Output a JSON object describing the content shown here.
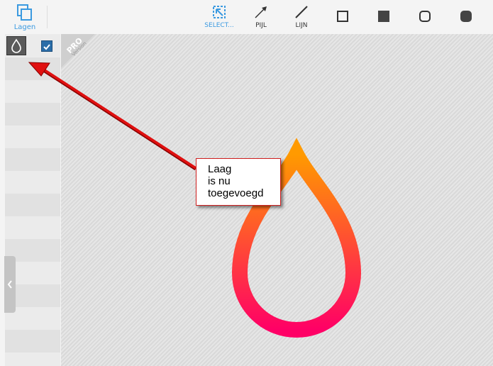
{
  "toolbar": {
    "layers_label": "Lagen",
    "tools": [
      {
        "label": "SELECT...",
        "icon": "select-icon",
        "active": true
      },
      {
        "label": "PIJL",
        "icon": "arrow-icon"
      },
      {
        "label": "LIJN",
        "icon": "line-icon"
      },
      {
        "label": "",
        "icon": "rectangle-outline-icon"
      },
      {
        "label": "",
        "icon": "rectangle-filled-icon"
      },
      {
        "label": "",
        "icon": "rounded-rectangle-outline-icon"
      },
      {
        "label": "",
        "icon": "rounded-rectangle-filled-icon"
      }
    ]
  },
  "badge": {
    "pro": "PRO",
    "version": "Version"
  },
  "callout": {
    "lines": [
      "Laag",
      "is nu",
      "toegevoegd"
    ]
  },
  "colors": {
    "accent": "#3b9ae0",
    "arrow": "#e01010",
    "drop_top": "#ff9a00",
    "drop_bottom": "#ff0066",
    "checkbox": "#2a6da8"
  },
  "layer": {
    "visible": true,
    "icon": "drop-icon"
  }
}
